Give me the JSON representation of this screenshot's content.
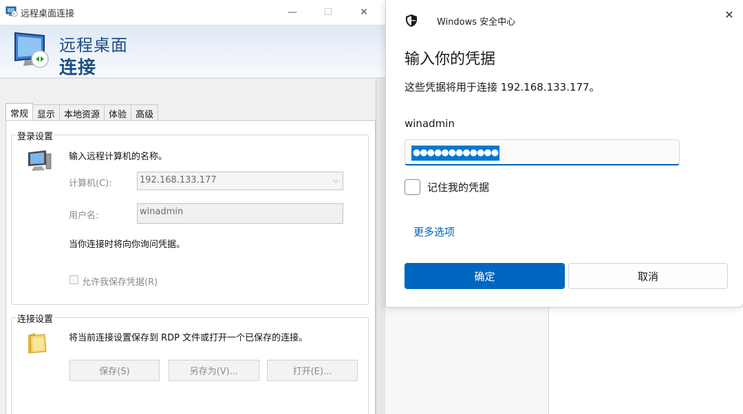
{
  "rdp_window": {
    "title": "远程桌面连接",
    "controls": {
      "minimize": "—",
      "maximize": "☐",
      "close": "✕"
    },
    "banner": {
      "line1": "远程桌面",
      "line2": "连接"
    },
    "tabs": [
      {
        "label": "常规",
        "active": true
      },
      {
        "label": "显示",
        "active": false
      },
      {
        "label": "本地资源",
        "active": false
      },
      {
        "label": "体验",
        "active": false
      },
      {
        "label": "高级",
        "active": false
      }
    ],
    "login_settings": {
      "title": "登录设置",
      "prompt": "输入远程计算机的名称。",
      "computer_label": "计算机(C):",
      "computer_value": "192.168.133.177",
      "username_label": "用户名:",
      "username_value": "winadmin",
      "note": "当你连接时将向你询问凭据。",
      "save_creds_label": "允许我保存凭据(R)",
      "save_creds_checked": false
    },
    "connection_settings": {
      "title": "连接设置",
      "description": "将当前连接设置保存到 RDP 文件或打开一个已保存的连接。",
      "buttons": {
        "save": "保存(S)",
        "save_as": "另存为(V)...",
        "open": "打开(E)..."
      }
    }
  },
  "security_dialog": {
    "app_name": "Windows 安全中心",
    "close_glyph": "✕",
    "heading": "输入你的凭据",
    "subtitle": "这些凭据将用于连接 192.168.133.177。",
    "username": "winadmin",
    "password_mask": "●●●●●●●●●●●●",
    "remember_label": "记住我的凭据",
    "remember_checked": false,
    "more_options": "更多选项",
    "ok_label": "确定",
    "cancel_label": "取消",
    "accent_color": "#0067c0"
  }
}
